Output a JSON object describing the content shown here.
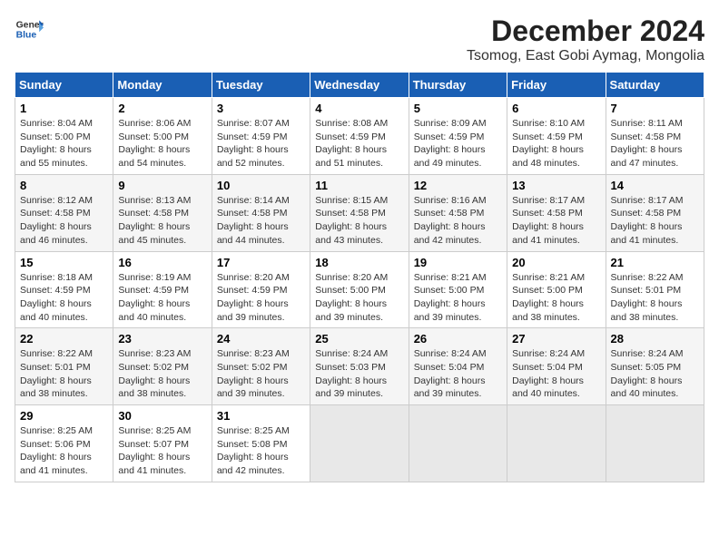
{
  "header": {
    "logo_line1": "General",
    "logo_line2": "Blue",
    "main_title": "December 2024",
    "sub_title": "Tsomog, East Gobi Aymag, Mongolia"
  },
  "columns": [
    "Sunday",
    "Monday",
    "Tuesday",
    "Wednesday",
    "Thursday",
    "Friday",
    "Saturday"
  ],
  "weeks": [
    [
      {
        "day": "1",
        "info": "Sunrise: 8:04 AM\nSunset: 5:00 PM\nDaylight: 8 hours and 55 minutes."
      },
      {
        "day": "2",
        "info": "Sunrise: 8:06 AM\nSunset: 5:00 PM\nDaylight: 8 hours and 54 minutes."
      },
      {
        "day": "3",
        "info": "Sunrise: 8:07 AM\nSunset: 4:59 PM\nDaylight: 8 hours and 52 minutes."
      },
      {
        "day": "4",
        "info": "Sunrise: 8:08 AM\nSunset: 4:59 PM\nDaylight: 8 hours and 51 minutes."
      },
      {
        "day": "5",
        "info": "Sunrise: 8:09 AM\nSunset: 4:59 PM\nDaylight: 8 hours and 49 minutes."
      },
      {
        "day": "6",
        "info": "Sunrise: 8:10 AM\nSunset: 4:59 PM\nDaylight: 8 hours and 48 minutes."
      },
      {
        "day": "7",
        "info": "Sunrise: 8:11 AM\nSunset: 4:58 PM\nDaylight: 8 hours and 47 minutes."
      }
    ],
    [
      {
        "day": "8",
        "info": "Sunrise: 8:12 AM\nSunset: 4:58 PM\nDaylight: 8 hours and 46 minutes."
      },
      {
        "day": "9",
        "info": "Sunrise: 8:13 AM\nSunset: 4:58 PM\nDaylight: 8 hours and 45 minutes."
      },
      {
        "day": "10",
        "info": "Sunrise: 8:14 AM\nSunset: 4:58 PM\nDaylight: 8 hours and 44 minutes."
      },
      {
        "day": "11",
        "info": "Sunrise: 8:15 AM\nSunset: 4:58 PM\nDaylight: 8 hours and 43 minutes."
      },
      {
        "day": "12",
        "info": "Sunrise: 8:16 AM\nSunset: 4:58 PM\nDaylight: 8 hours and 42 minutes."
      },
      {
        "day": "13",
        "info": "Sunrise: 8:17 AM\nSunset: 4:58 PM\nDaylight: 8 hours and 41 minutes."
      },
      {
        "day": "14",
        "info": "Sunrise: 8:17 AM\nSunset: 4:58 PM\nDaylight: 8 hours and 41 minutes."
      }
    ],
    [
      {
        "day": "15",
        "info": "Sunrise: 8:18 AM\nSunset: 4:59 PM\nDaylight: 8 hours and 40 minutes."
      },
      {
        "day": "16",
        "info": "Sunrise: 8:19 AM\nSunset: 4:59 PM\nDaylight: 8 hours and 40 minutes."
      },
      {
        "day": "17",
        "info": "Sunrise: 8:20 AM\nSunset: 4:59 PM\nDaylight: 8 hours and 39 minutes."
      },
      {
        "day": "18",
        "info": "Sunrise: 8:20 AM\nSunset: 5:00 PM\nDaylight: 8 hours and 39 minutes."
      },
      {
        "day": "19",
        "info": "Sunrise: 8:21 AM\nSunset: 5:00 PM\nDaylight: 8 hours and 39 minutes."
      },
      {
        "day": "20",
        "info": "Sunrise: 8:21 AM\nSunset: 5:00 PM\nDaylight: 8 hours and 38 minutes."
      },
      {
        "day": "21",
        "info": "Sunrise: 8:22 AM\nSunset: 5:01 PM\nDaylight: 8 hours and 38 minutes."
      }
    ],
    [
      {
        "day": "22",
        "info": "Sunrise: 8:22 AM\nSunset: 5:01 PM\nDaylight: 8 hours and 38 minutes."
      },
      {
        "day": "23",
        "info": "Sunrise: 8:23 AM\nSunset: 5:02 PM\nDaylight: 8 hours and 38 minutes."
      },
      {
        "day": "24",
        "info": "Sunrise: 8:23 AM\nSunset: 5:02 PM\nDaylight: 8 hours and 39 minutes."
      },
      {
        "day": "25",
        "info": "Sunrise: 8:24 AM\nSunset: 5:03 PM\nDaylight: 8 hours and 39 minutes."
      },
      {
        "day": "26",
        "info": "Sunrise: 8:24 AM\nSunset: 5:04 PM\nDaylight: 8 hours and 39 minutes."
      },
      {
        "day": "27",
        "info": "Sunrise: 8:24 AM\nSunset: 5:04 PM\nDaylight: 8 hours and 40 minutes."
      },
      {
        "day": "28",
        "info": "Sunrise: 8:24 AM\nSunset: 5:05 PM\nDaylight: 8 hours and 40 minutes."
      }
    ],
    [
      {
        "day": "29",
        "info": "Sunrise: 8:25 AM\nSunset: 5:06 PM\nDaylight: 8 hours and 41 minutes."
      },
      {
        "day": "30",
        "info": "Sunrise: 8:25 AM\nSunset: 5:07 PM\nDaylight: 8 hours and 41 minutes."
      },
      {
        "day": "31",
        "info": "Sunrise: 8:25 AM\nSunset: 5:08 PM\nDaylight: 8 hours and 42 minutes."
      },
      {
        "day": "",
        "info": ""
      },
      {
        "day": "",
        "info": ""
      },
      {
        "day": "",
        "info": ""
      },
      {
        "day": "",
        "info": ""
      }
    ]
  ]
}
